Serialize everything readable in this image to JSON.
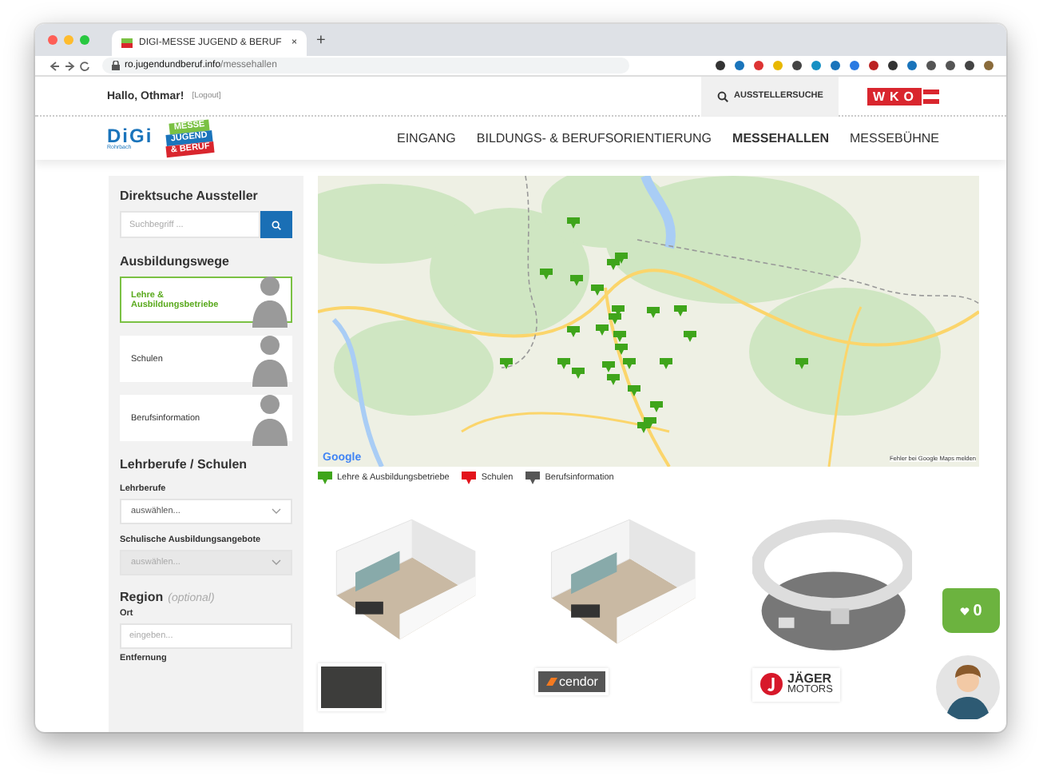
{
  "browser": {
    "tab_title": "DIGI-MESSE JUGEND & BERUF",
    "close_tab": "×",
    "new_tab": "+",
    "url_host": "ro.jugendundberuf.info",
    "url_path": "/messehallen"
  },
  "header": {
    "greeting": "Hallo, Othmar!",
    "logout": "[Logout]",
    "search_button": "AUSSTELLERSUCHE",
    "wko_logo": "WKO"
  },
  "logos": {
    "digi": "DiGi",
    "digi_sub": "Rohrbach",
    "messe": [
      "MESSE",
      "JUGEND",
      "& BERUF"
    ]
  },
  "nav": [
    {
      "label": "EINGANG",
      "selected": false
    },
    {
      "label": "BILDUNGS- & BERUFSORIENTIERUNG",
      "selected": false
    },
    {
      "label": "MESSEHALLEN",
      "selected": true
    },
    {
      "label": "MESSEBÜHNE",
      "selected": false
    }
  ],
  "sidebar": {
    "search_title": "Direktsuche Aussteller",
    "search_placeholder": "Suchbegriff ...",
    "paths_title": "Ausbildungswege",
    "paths": [
      {
        "label": "Lehre & Ausbildungsbetriebe",
        "selected": true
      },
      {
        "label": "Schulen",
        "selected": false
      },
      {
        "label": "Berufsinformation",
        "selected": false
      }
    ],
    "filters_title": "Lehrberufe / Schulen",
    "filters": [
      {
        "label": "Lehrberufe",
        "value": "auswählen...",
        "disabled": false
      },
      {
        "label": "Schulische Ausbildungsangebote",
        "value": "auswählen...",
        "disabled": true
      }
    ],
    "region_title": "Region",
    "region_note": "(optional)",
    "place_label": "Ort",
    "place_placeholder": "eingeben...",
    "distance_label": "Entfernung"
  },
  "map": {
    "google": "Google",
    "report_link": "Fehler bei Google Maps melden"
  },
  "legend": [
    {
      "label": "Lehre & Ausbildungsbetriebe",
      "color": "#3fa51b"
    },
    {
      "label": "Schulen",
      "color": "#e3131b"
    },
    {
      "label": "Berufsinformation",
      "color": "#555555"
    }
  ],
  "booths": [
    {
      "kind": "box",
      "logo": {
        "kind": "dark"
      }
    },
    {
      "kind": "box",
      "logo": {
        "kind": "wordmark",
        "text": "cendor"
      }
    },
    {
      "kind": "round",
      "logo": {
        "kind": "stacked",
        "lines": [
          "JÄGER",
          "MOTORS"
        ]
      }
    }
  ],
  "cart": {
    "count": "0"
  }
}
